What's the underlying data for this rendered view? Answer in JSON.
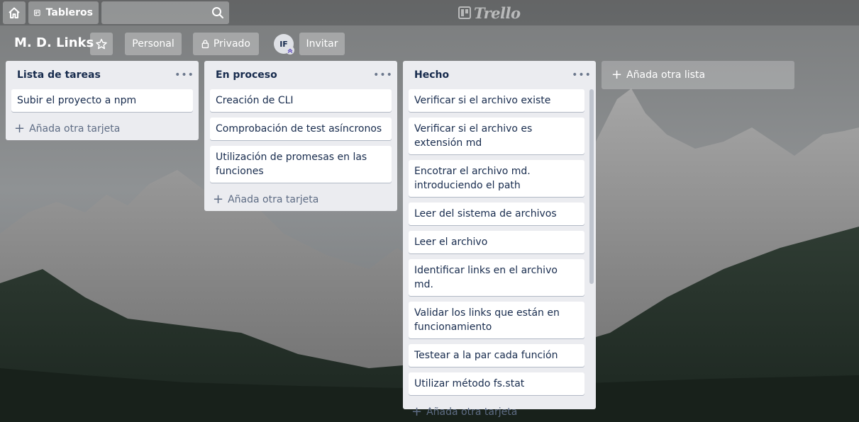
{
  "header": {
    "boards_label": "Tableros",
    "search_placeholder": "",
    "logo_text": "Trello"
  },
  "board": {
    "title": "M. D. Links",
    "personal_label": "Personal",
    "privacy_label": "Privado",
    "avatar_initials": "IF",
    "invite_label": "Invitar"
  },
  "lists": [
    {
      "title": "Lista de tareas",
      "cards": [
        "Subir el proyecto a npm"
      ],
      "add_card_label": "Añada otra tarjeta"
    },
    {
      "title": "En proceso",
      "cards": [
        "Creación de CLI",
        "Comprobación de test asíncronos",
        "Utilización de promesas en las funciones"
      ],
      "add_card_label": "Añada otra tarjeta"
    },
    {
      "title": "Hecho",
      "cards": [
        "Verificar si el archivo existe",
        "Verificar si el archivo es extensión md",
        "Encotrar el archivo md. introduciendo el path",
        "Leer del sistema de archivos",
        "Leer el archivo",
        "Identificar links en el archivo md.",
        "Validar los links que están en funcionamiento",
        "Testear a la par cada función",
        "Utilizar método fs.stat"
      ],
      "add_card_label": "Añada otra tarjeta"
    }
  ],
  "add_list_label": "Añada otra lista",
  "colors": {
    "list_bg": "#ebecf0",
    "card_bg": "#ffffff",
    "text": "#172b4d",
    "muted": "#5e6c84"
  }
}
